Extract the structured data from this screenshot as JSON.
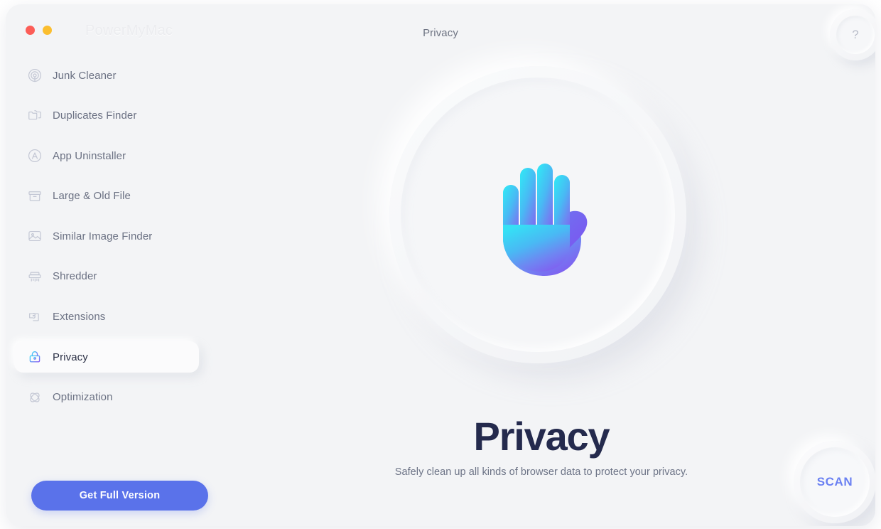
{
  "window": {
    "brand": "PowerMyMac",
    "title": "Privacy",
    "help_glyph": "?",
    "traffic_lights": [
      "close-red",
      "minimize-yellow"
    ]
  },
  "sidebar": {
    "items": [
      {
        "id": "junk-cleaner",
        "label": "Junk Cleaner",
        "icon": "target-icon",
        "active": false
      },
      {
        "id": "duplicates-finder",
        "label": "Duplicates Finder",
        "icon": "folders-icon",
        "active": false
      },
      {
        "id": "app-uninstaller",
        "label": "App Uninstaller",
        "icon": "app-circle-icon",
        "active": false
      },
      {
        "id": "large-old-file",
        "label": "Large & Old File",
        "icon": "archive-box-icon",
        "active": false
      },
      {
        "id": "similar-image-finder",
        "label": "Similar Image Finder",
        "icon": "photo-icon",
        "active": false
      },
      {
        "id": "shredder",
        "label": "Shredder",
        "icon": "shredder-icon",
        "active": false
      },
      {
        "id": "extensions",
        "label": "Extensions",
        "icon": "puzzle-piece-icon",
        "active": false
      },
      {
        "id": "privacy",
        "label": "Privacy",
        "icon": "lock-icon",
        "active": true
      },
      {
        "id": "optimization",
        "label": "Optimization",
        "icon": "atom-icon",
        "active": false
      }
    ],
    "cta_label": "Get Full Version"
  },
  "main": {
    "illustration": "raised-hand-icon",
    "title": "Privacy",
    "subtitle": "Safely clean up all kinds of browser data to protect your privacy.",
    "scan_label": "SCAN"
  },
  "colors": {
    "background": "#f3f4f6",
    "accent_blue": "#5a72ea",
    "scan_text": "#6a80f2",
    "title_navy": "#242a4d",
    "sidebar_text": "#6b7183",
    "traffic_red": "#fc5d57",
    "traffic_yellow": "#fbbe2f",
    "gradient_start": "#3ddcf7",
    "gradient_end": "#7a5cf0"
  }
}
